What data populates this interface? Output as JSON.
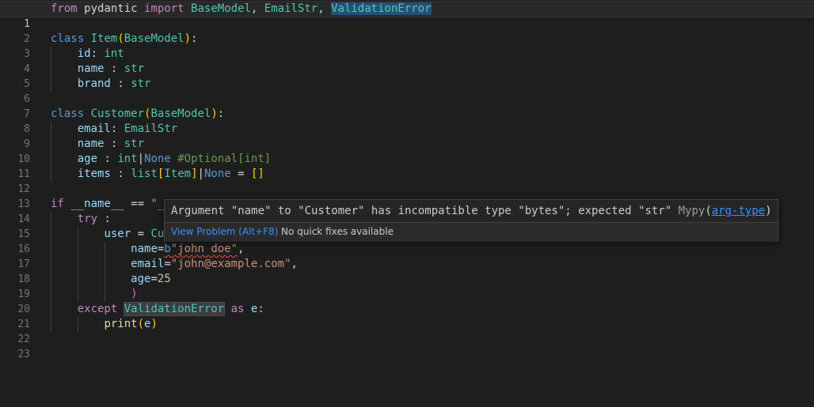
{
  "editor": {
    "line_numbers": [
      "1",
      "2",
      "3",
      "4",
      "5",
      "6",
      "7",
      "8",
      "9",
      "10",
      "11",
      "12",
      "13",
      "14",
      "15",
      "16",
      "17",
      "18",
      "19",
      "20",
      "21",
      "22",
      "23"
    ],
    "l1": {
      "from": "from",
      "module": "pydantic",
      "import": "import",
      "n1": "BaseModel",
      "c1": ",",
      "n2": "EmailStr",
      "c2": ",",
      "n3": "ValidationError"
    },
    "l3": {
      "class": "class",
      "name": "Item",
      "open": "(",
      "base": "BaseModel",
      "close": ")",
      "colon": ":"
    },
    "l4": {
      "field": "id",
      "colon": ":",
      "type": "int"
    },
    "l5": {
      "field": "name",
      "colon": ":",
      "type": "str"
    },
    "l6": {
      "field": "brand",
      "colon": ":",
      "type": "str"
    },
    "l8": {
      "class": "class",
      "name": "Customer",
      "open": "(",
      "base": "BaseModel",
      "close": ")",
      "colon": ":"
    },
    "l9": {
      "field": "email",
      "colon": ":",
      "type": "EmailStr"
    },
    "l10": {
      "field": "name",
      "colon": ":",
      "type": "str"
    },
    "l11": {
      "field": "age",
      "colon": ":",
      "type": "int",
      "pipe": "|",
      "none": "None",
      "comment": "#Optional[int]"
    },
    "l12": {
      "field": "items",
      "colon": ":",
      "type": "list",
      "open": "[",
      "inner": "Item",
      "close": "]",
      "pipe": "|",
      "none": "None",
      "eq": "=",
      "default": "[]"
    },
    "l14": {
      "kw": "if",
      "dunder": "__name__",
      "eq": "==",
      "str": "\"_"
    },
    "l15": {
      "kw": "try",
      "colon": ":"
    },
    "l16": {
      "var": "user",
      "eq": "=",
      "partial": "Cu"
    },
    "l17": {
      "arg": "name",
      "eq": "=",
      "prefix": "b",
      "value": "\"john doe\"",
      "comma": ","
    },
    "l18": {
      "arg": "email",
      "eq": "=",
      "value": "\"john@example.com\"",
      "comma": ","
    },
    "l19": {
      "arg": "age",
      "eq": "=",
      "value": "25"
    },
    "l20": {
      "close": ")"
    },
    "l21": {
      "kw": "except",
      "exc": "ValidationError",
      "as": "as",
      "var": "e",
      "colon": ":"
    },
    "l22": {
      "fn": "print",
      "open": "(",
      "arg": "e",
      "close": ")"
    }
  },
  "hover": {
    "message": "Argument \"name\" to \"Customer\" has incompatible type \"bytes\"; expected \"str\"",
    "source": "Mypy",
    "open_paren": "(",
    "code": "arg-type",
    "close_paren": ")",
    "view_problem": "View Problem (Alt+F8)",
    "no_quick_fix": "No quick fixes available"
  },
  "colors": {
    "background": "#1e1e1e",
    "keyword": "#c586c0",
    "type": "#4ec9b0",
    "variable": "#9cdcfe",
    "string": "#ce9178",
    "error": "#f14c4c",
    "link": "#3794ff"
  }
}
